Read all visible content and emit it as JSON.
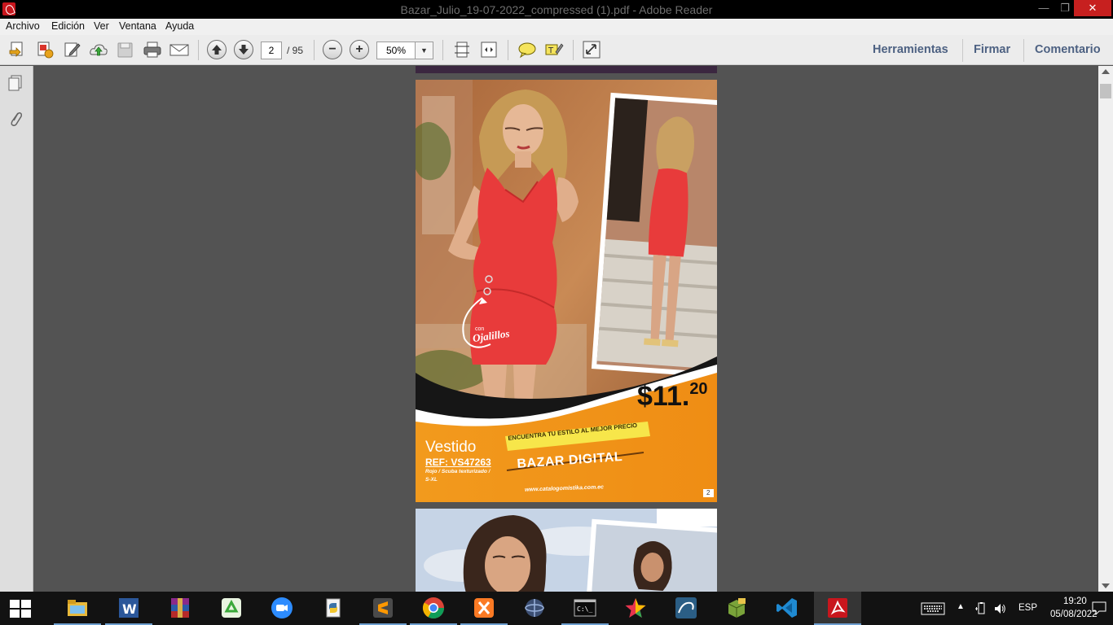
{
  "window": {
    "title": "Bazar_Julio_19-07-2022_compressed (1).pdf - Adobe Reader",
    "minimize_label": "—",
    "maximize_label": "❐",
    "close_label": "✕"
  },
  "menu": {
    "items": [
      "Archivo",
      "Edición",
      "Ver",
      "Ventana",
      "Ayuda"
    ]
  },
  "toolbar": {
    "current_page": "2",
    "total_pages": "/ 95",
    "zoom": "50%",
    "zoom_out_label": "−",
    "zoom_in_label": "+",
    "links": [
      "Herramientas",
      "Firmar",
      "Comentario"
    ],
    "icons": [
      "open-icon",
      "create-pdf-icon",
      "edit-icon",
      "upload-icon",
      "save-icon",
      "print-icon",
      "email-icon",
      "prev-page-icon",
      "next-page-icon",
      "zoom-out-icon",
      "zoom-in-icon",
      "fit-page-icon",
      "fit-width-icon",
      "comment-icon",
      "highlight-icon",
      "fullscreen-icon"
    ]
  },
  "page2": {
    "price_main": "$11.",
    "price_cents": "20",
    "callout": "Ojalillos",
    "callout_small": "con",
    "product_name": "Vestido",
    "ref": "REF: VS47263",
    "desc_line1": "Rojo / Scuba texturizado /",
    "desc_line2": "S-XL",
    "banner_small": "ENCUENTRA TU ESTILO AL MEJOR PRECIO",
    "banner_big": "BAZAR DIGITAL",
    "website": "www.catalogomistika.com.ec",
    "page_number": "2"
  },
  "taskbar": {
    "apps": [
      "file-explorer-icon",
      "word-icon",
      "winrar-icon",
      "recycle-app-icon",
      "zoom-icon",
      "python-icon",
      "sublime-text-icon",
      "chrome-icon",
      "xampp-icon",
      "network-app-icon",
      "terminal-icon",
      "star-app-icon",
      "mysql-workbench-icon",
      "package-app-icon",
      "vscode-icon",
      "acrobat-icon"
    ],
    "active_app": "acrobat-icon",
    "language": "ESP",
    "time": "19:20",
    "date": "05/08/2022"
  },
  "colors": {
    "title_bar": "#000000",
    "menu_bar": "#f0f0f0",
    "toolbar": "#ececec",
    "doc_background": "#535353",
    "close_button": "#c7201f",
    "link_text": "#4d6182",
    "page_orange": "#f0941e",
    "dress_red": "#e83b3b"
  }
}
